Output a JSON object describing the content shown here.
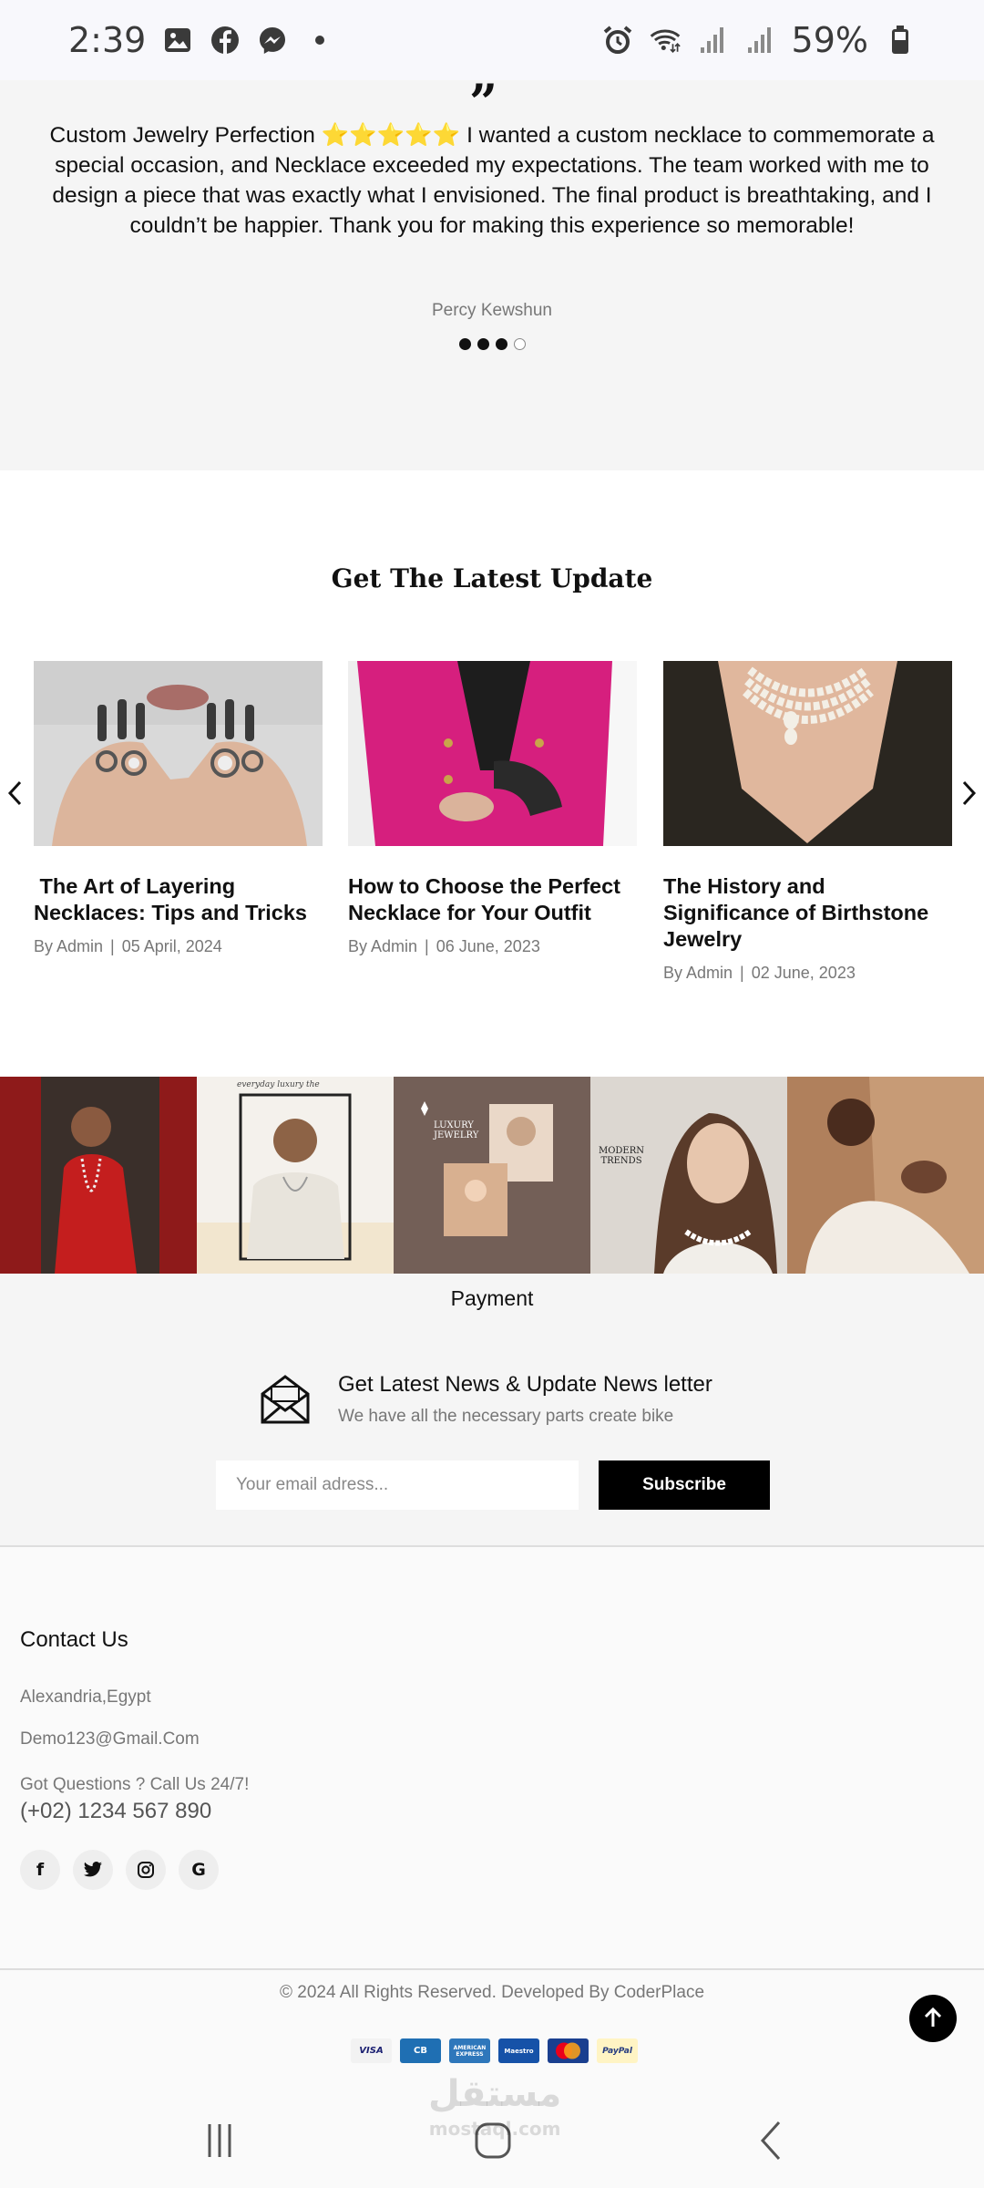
{
  "status_bar": {
    "time": "2:39",
    "battery": "59%",
    "left_icons": [
      "gallery-icon",
      "facebook-icon",
      "messenger-icon",
      "dot-icon"
    ],
    "right_icons": [
      "alarm-icon",
      "wifi-icon",
      "signal-icon",
      "signal-icon-2",
      "battery-icon"
    ]
  },
  "testimonial": {
    "text": "Custom Jewelry Perfection ⭐⭐⭐⭐⭐ I wanted a custom necklace to commemorate a special occasion, and Necklace exceeded my expectations. The team worked with me to design a piece that was exactly what I envisioned. The final product is breathtaking, and I couldn’t be happier. Thank you for making this experience so memorable!",
    "author": "Percy Kewshun",
    "dots_total": 4,
    "active_dot": 3
  },
  "blog": {
    "title": "Get The Latest Update",
    "posts": [
      {
        "title": " The Art of Layering Necklaces: Tips and Tricks",
        "author": "By Admin",
        "date": "05 April, 2024"
      },
      {
        "title": "How to Choose the Perfect Necklace for Your Outfit",
        "author": "By Admin",
        "date": "06 June, 2023"
      },
      {
        "title": "The History and Significance of Birthstone Jewelry",
        "author": "By Admin",
        "date": "02 June, 2023"
      }
    ]
  },
  "gallery": {
    "tile2_caption": "everyday luxury the",
    "tile3_caption": "LUXURY JEWELRY",
    "tile4_caption": "MODERN TRENDS"
  },
  "newsletter": {
    "payment_label": "Payment",
    "title": "Get Latest News & Update News letter",
    "subtitle": "We have all the necessary parts create bike",
    "email_placeholder": "Your email adress...",
    "subscribe_label": "Subscribe"
  },
  "contact": {
    "title": "Contact Us",
    "address": "Alexandria,Egypt",
    "email": "Demo123@Gmail.Com",
    "questions": "Got Questions ? Call Us 24/7!",
    "phone": "(+02) 1234 567 890",
    "socials": [
      "facebook-icon",
      "twitter-icon",
      "instagram-icon",
      "google-icon"
    ]
  },
  "footer": {
    "copyright": "© 2024 All Rights Reserved. Developed By CoderPlace",
    "payment_cards": [
      "VISA",
      "CB",
      "AMERICAN EXPRESS",
      "Maestro",
      "MasterCard",
      "PayPal"
    ]
  },
  "watermark": {
    "arabic": "مستقل",
    "latin": "mostaql.com"
  }
}
